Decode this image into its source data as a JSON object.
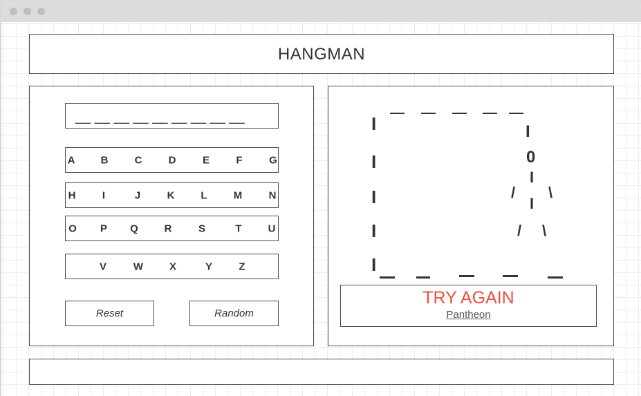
{
  "window": {
    "controls": [
      "close",
      "minimize",
      "maximize"
    ]
  },
  "header": {
    "title": "HANGMAN"
  },
  "word": {
    "blanks": "__ __ __ __ __ __ __ __ __"
  },
  "keyboard": {
    "row1": [
      "A",
      "B",
      "C",
      "D",
      "E",
      "F",
      "G"
    ],
    "row2": [
      "H",
      "I",
      "J",
      "K",
      "L",
      "M",
      "N"
    ],
    "row3": [
      "O",
      "P",
      "Q",
      "R",
      "S",
      "T",
      "U"
    ],
    "row4": [
      "V",
      "W",
      "X",
      "Y",
      "Z"
    ]
  },
  "buttons": {
    "reset": "Reset",
    "random": "Random"
  },
  "gallows": {
    "head": "0",
    "body": "I",
    "left_limb": "/",
    "right_limb": "\\",
    "post": "I"
  },
  "result": {
    "message": "TRY AGAIN",
    "link": "Pantheon",
    "message_color": "#e9503f"
  },
  "footer": {
    "text": ""
  }
}
